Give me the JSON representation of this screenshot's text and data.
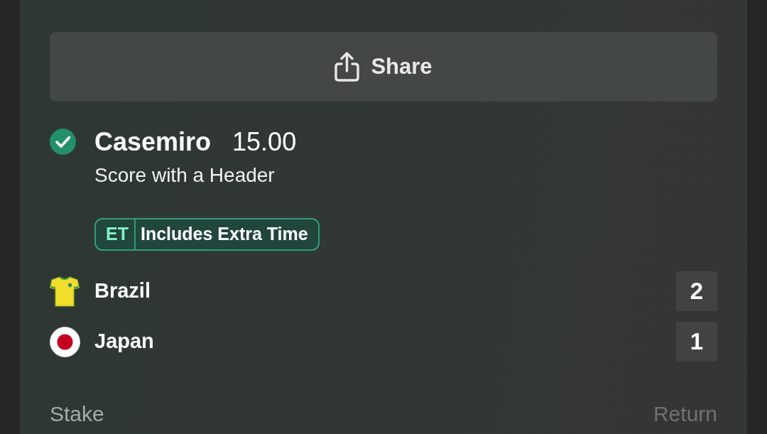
{
  "share_button": {
    "label": "Share"
  },
  "selection": {
    "won": true,
    "name": "Casemiro",
    "odds": "15.00",
    "market": "Score with a Header",
    "badge": {
      "code": "ET",
      "label": "Includes Extra Time"
    }
  },
  "teams": [
    {
      "kind": "shirt",
      "name": "Brazil",
      "score": "2"
    },
    {
      "kind": "flag",
      "name": "Japan",
      "score": "1"
    }
  ],
  "footer": {
    "stake_label": "Stake",
    "return_label": "Return"
  }
}
